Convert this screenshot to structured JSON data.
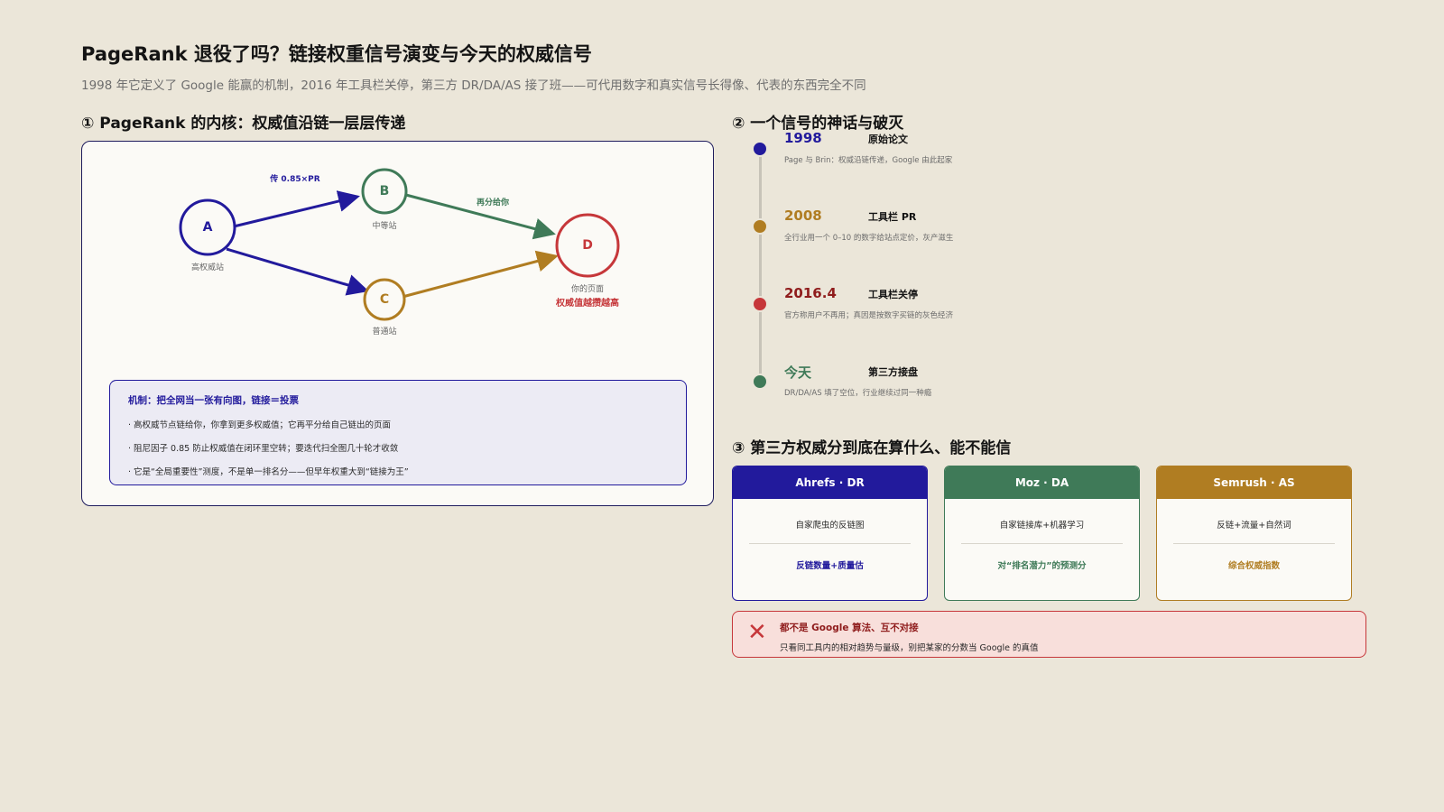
{
  "header": {
    "title": "PageRank 退役了吗？链接权重信号演变与今天的权威信号",
    "subtitle": "1998 年它定义了 Google 能赢的机制，2016 年工具栏关停，第三方 DR/DA/AS 接了班——可代用数字和真实信号长得像、代表的东西完全不同"
  },
  "section1": {
    "heading": "① PageRank 的内核：权威值沿链一层层传递",
    "nodes": {
      "a": {
        "letter": "A",
        "label": "高权威站",
        "color": "#221a9c"
      },
      "b": {
        "letter": "B",
        "label": "中等站",
        "color": "#3f7a58"
      },
      "c": {
        "letter": "C",
        "label": "普通站",
        "color": "#b07d22"
      },
      "d": {
        "letter": "D",
        "label": "你的页面",
        "note": "权威值越攒越高",
        "color": "#c6373a"
      }
    },
    "edge_labels": {
      "ab": "传 0.85×PR",
      "bd": "再分给你"
    },
    "mechanism": {
      "title": "机制：把全网当一张有向图，链接＝投票",
      "items": [
        "· 高权威节点链给你，你拿到更多权威值；它再平分给自己链出的页面",
        "· 阻尼因子 0.85 防止权威值在闭环里空转；要迭代扫全图几十轮才收敛",
        "· 它是“全局重要性”测度，不是单一排名分——但早年权重大到“链接为王”"
      ]
    }
  },
  "section2": {
    "heading": "② 一个信号的神话与破灭",
    "events": [
      {
        "year": "1998",
        "title": "原始论文",
        "desc": "Page 与 Brin：权威沿链传递，Google 由此起家",
        "color": "#221a9c"
      },
      {
        "year": "2008",
        "title": "工具栏 PR",
        "desc": "全行业用一个 0–10 的数字给站点定价，灰产滋生",
        "color": "#b07d22"
      },
      {
        "year": "2016.4",
        "title": "工具栏关停",
        "desc": "官方称用户不再用；真因是按数字买链的灰色经济",
        "color": "#c6373a"
      },
      {
        "year": "今天",
        "title": "第三方接盘",
        "desc": "DR/DA/AS 填了空位，行业继续过同一种瘾",
        "color": "#3f7a58"
      }
    ]
  },
  "section3": {
    "heading": "③ 第三方权威分到底在算什么、能不能信",
    "cards": [
      {
        "name": "Ahrefs · DR",
        "source": "自家爬虫的反链图",
        "measure": "反链数量+质量估",
        "color": "#221a9c"
      },
      {
        "name": "Moz · DA",
        "source": "自家链接库+机器学习",
        "measure": "对“排名潜力”的预测分",
        "color": "#3f7a58"
      },
      {
        "name": "Semrush · AS",
        "source": "反链+流量+自然词",
        "measure": "综合权威指数",
        "color": "#b07d22"
      }
    ],
    "warning": {
      "icon": "close-icon",
      "title": "都不是 Google 算法、互不对接",
      "text": "只看同工具内的相对趋势与量级，别把某家的分数当 Google 的真值"
    }
  }
}
